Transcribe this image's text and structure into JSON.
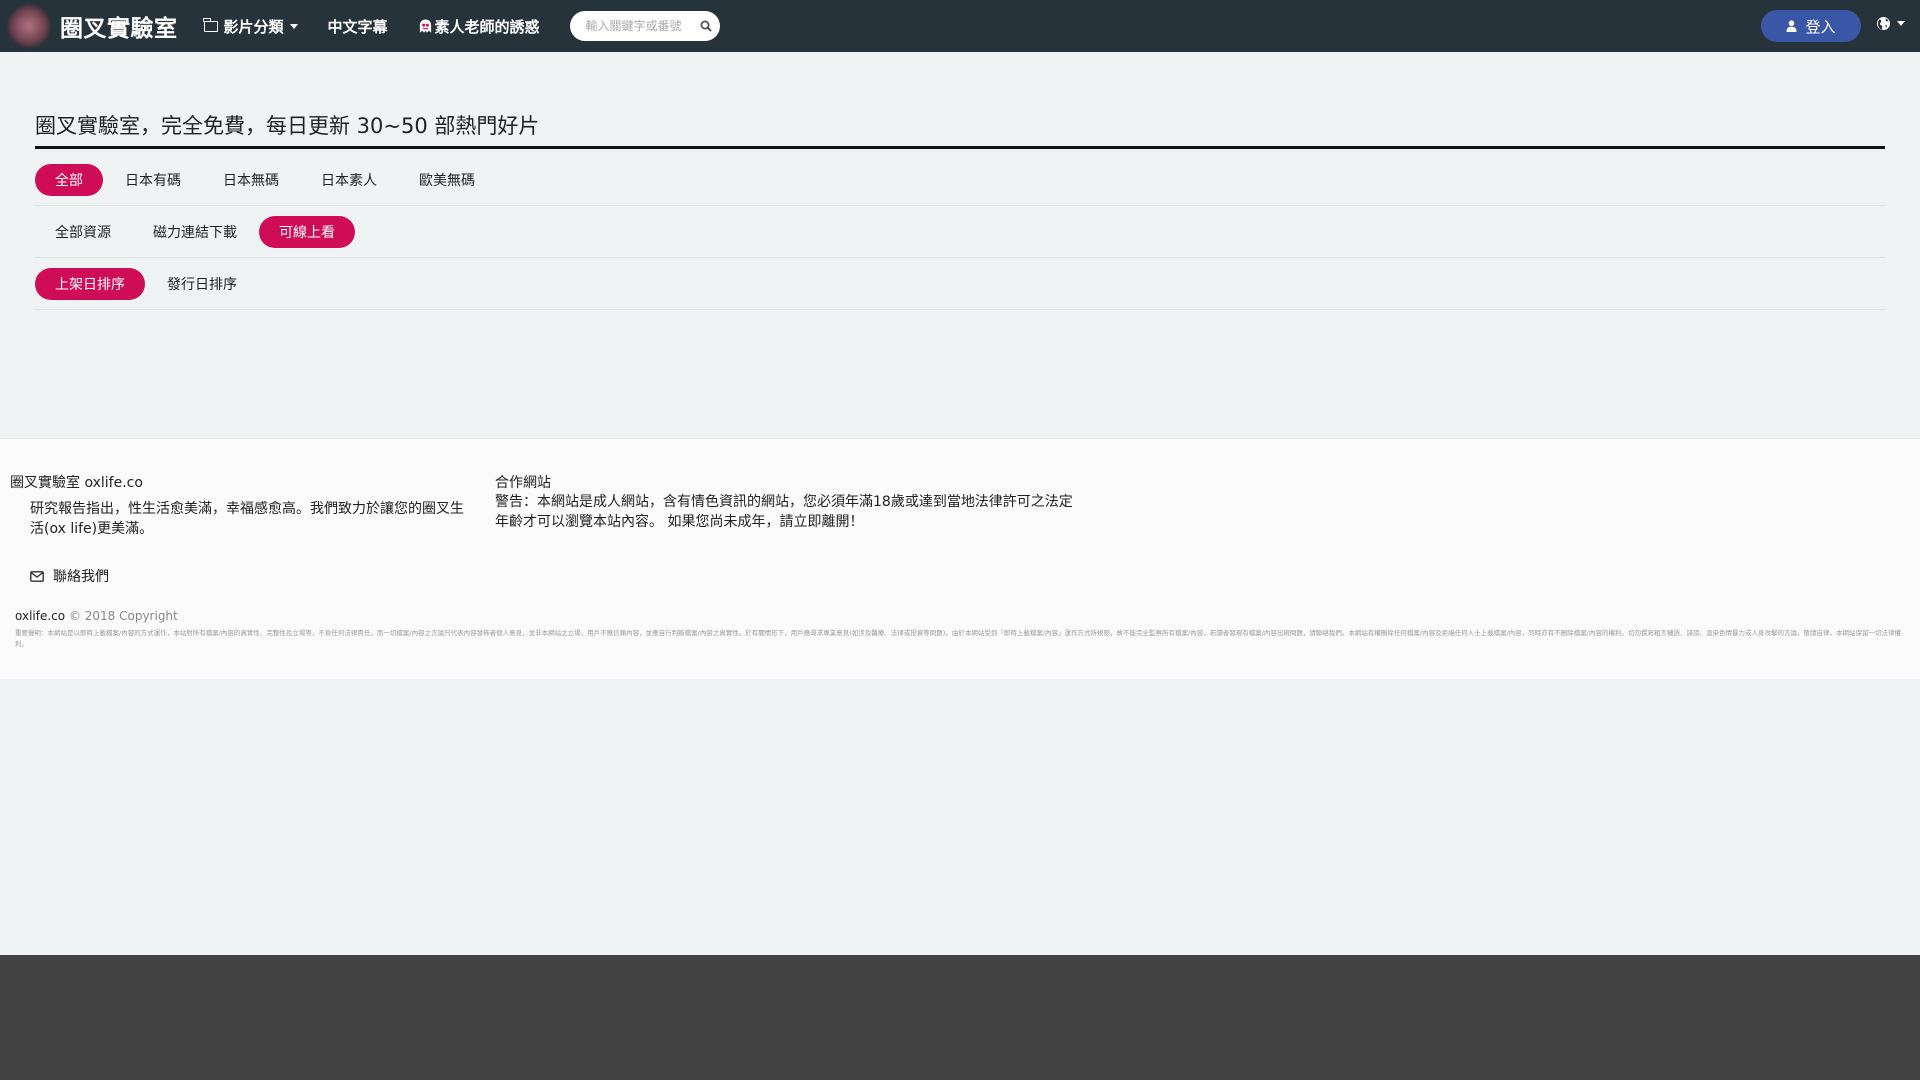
{
  "nav": {
    "brand": "圈叉實驗室",
    "categories_label": "影片分類",
    "subtitles_label": "中文字幕",
    "teacher_label": "素人老師的誘惑",
    "search_placeholder": "輸入關鍵字或番號",
    "login_label": "登入"
  },
  "main": {
    "title": "圈叉實驗室，完全免費，每日更新 30~50 部熱門好片",
    "region_filters": [
      {
        "label": "全部",
        "active": true
      },
      {
        "label": "日本有碼",
        "active": false
      },
      {
        "label": "日本無碼",
        "active": false
      },
      {
        "label": "日本素人",
        "active": false
      },
      {
        "label": "歐美無碼",
        "active": false
      }
    ],
    "source_filters": [
      {
        "label": "全部資源",
        "active": false
      },
      {
        "label": "磁力連結下載",
        "active": false
      },
      {
        "label": "可線上看",
        "active": true
      }
    ],
    "sort_filters": [
      {
        "label": "上架日排序",
        "active": true
      },
      {
        "label": "發行日排序",
        "active": false
      }
    ]
  },
  "footer": {
    "site_name": "圈叉實驗室 oxlife.co",
    "description": "研究報告指出，性生活愈美滿，幸福感愈高。我們致力於讓您的圈叉生活(ox life)更美滿。",
    "contact_label": "聯絡我們",
    "partners_label": "合作網站",
    "warning": "警告：本網站是成人網站，含有情色資訊的網站，您必須年滿18歲或達到當地法律許可之法定年齡才可以瀏覽本站內容。 如果您尚未成年，請立即離開！",
    "copyright_domain": "oxlife.co",
    "copyright_text": "© 2018 Copyright",
    "disclaimer": "重要聲明：本網站是以即時上載檔案/內容的方式運作，本站對所有檔案/內容的真實性、完整性及立場等，不負任何法律責任。而一切檔案/內容之言論只代表內容發佈者個人意見，並非本網站之立場，用戶不應信賴內容，並應自行判斷檔案/內容之真實性。於有關情形下，用戶應尋求專業意見(如涉及醫療、法律或投資等問題)。由於本網站受到「即時上載檔案/內容」運作方式所規限，故不能完全監察所有檔案/內容，若讀者發現有檔案/內容出現問題，請聯絡我們。本網站有權刪除任何檔案/內容及拒絕任何人士上載檔案/內容，同時亦有不刪除檔案/內容的權利。切勿撰寫粗言穢語、誹謗、渲染色情暴力或人身攻擊的言論，敬請自律。本網站保留一切法律權利。"
  }
}
